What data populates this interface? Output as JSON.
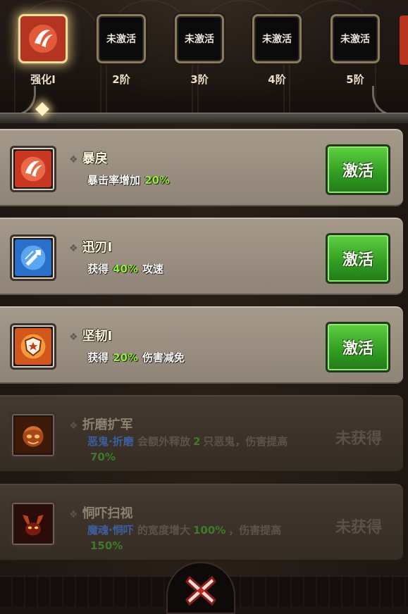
{
  "tiers": [
    {
      "label": "强化I",
      "state": "active",
      "icon": "rage-claw-icon"
    },
    {
      "label": "2阶",
      "state_text": "未激活",
      "icon": "none"
    },
    {
      "label": "3阶",
      "state_text": "未激活",
      "icon": "none"
    },
    {
      "label": "4阶",
      "state_text": "未激活",
      "icon": "none"
    },
    {
      "label": "5阶",
      "state_text": "未激活",
      "icon": "none"
    }
  ],
  "skills": [
    {
      "name": "暴戾",
      "desc_pre": "暴击率增加",
      "value": "20%",
      "desc_post": "",
      "button": "激活",
      "icon": "rage-claw-icon",
      "icon_color": "#c8371f"
    },
    {
      "name": "迅刃I",
      "desc_pre": "获得",
      "value": "40%",
      "desc_post": "攻速",
      "button": "激活",
      "icon": "swift-blade-icon",
      "icon_color": "#2a6fc9"
    },
    {
      "name": "坚韧I",
      "desc_pre": "获得",
      "value": "20%",
      "desc_post": "伤害减免",
      "button": "激活",
      "icon": "shield-burst-icon",
      "icon_color": "#d1571c"
    }
  ],
  "locked_skills": [
    {
      "name": "折磨扩军",
      "keyword": "恶鬼·折磨",
      "text1": "会额外释放",
      "num1": "2",
      "text2": "只恶鬼，伤害提高",
      "num2": "70%",
      "status": "未获得",
      "icon": "ghost-fire-icon"
    },
    {
      "name": "恫吓扫视",
      "keyword": "魔魂·恫吓",
      "text1": "的宽度增大",
      "num1": "100%",
      "text2": "，伤害提高",
      "num2": "150%",
      "status": "未获得",
      "icon": "demon-horn-icon"
    }
  ],
  "colors": {
    "accent_green": "#3fae2a",
    "value_green": "#8fef3c",
    "keyword_blue": "#3d5fa0"
  }
}
